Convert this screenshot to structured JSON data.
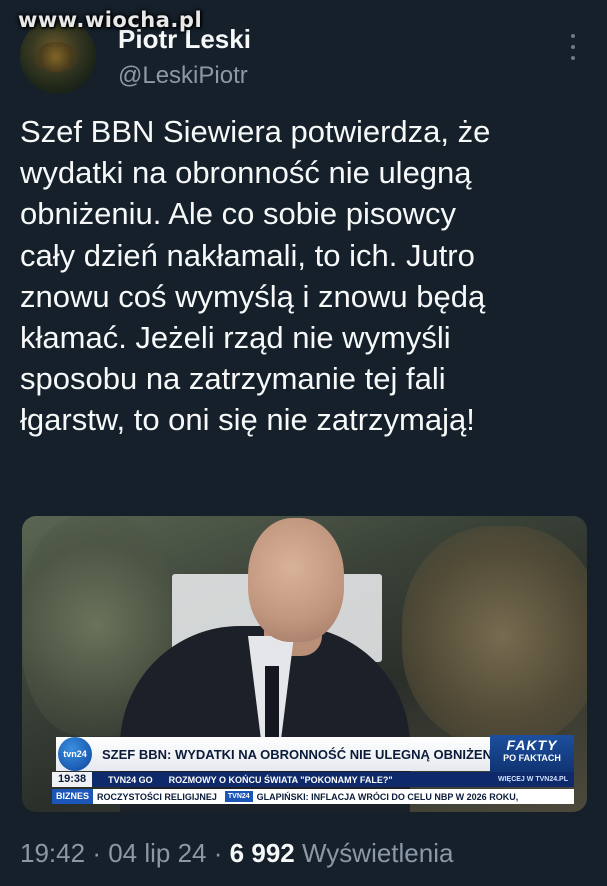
{
  "watermark": "www.wiocha.pl",
  "author": {
    "name": "Piotr Leski",
    "handle": "@LeskiPiotr"
  },
  "tweet": {
    "lines": [
      "Szef BBN Siewiera potwierdza, że",
      "wydatki na obronność nie ulegną",
      "obniżeniu. Ale co sobie pisowcy",
      "cały dzień nakłamali, to ich. Jutro",
      "znowu coś wymyślą i znowu będą",
      "kłamać. Jeżeli rząd nie wymyśli",
      "sposobu na zatrzymanie tej fali",
      "łgarstw, to oni się nie zatrzymają!"
    ]
  },
  "media": {
    "tvn_logo": "tvn24",
    "headline": "SZEF BBN: WYDATKI NA OBRONNOŚĆ NIE ULEGNĄ OBNIŻENIU",
    "fakty_title": "FAKTY",
    "fakty_sub": "PO FAKTACH",
    "clock": "19:38",
    "channel": "TVN24 GO",
    "program": "ROZMOWY O KOŃCU ŚWIATA \"POKONAMY FALE?\"",
    "more": "WIĘCEJ W TVN24.PL",
    "biz_label": "BIZNES",
    "ticker_left": "ROCZYSTOŚCI RELIGIJNEJ",
    "ticker_tag": "TVN24",
    "ticker_right": "GLAPIŃSKI: INFLACJA WRÓCI DO CELU NBP W 2026 ROKU,"
  },
  "footer": {
    "time": "19:42",
    "sep": "·",
    "date": "04 lip 24",
    "views_count": "6 992",
    "views_label": "Wyświetlenia"
  },
  "icons": [
    "more-options-icon",
    "tvn24-logo-icon"
  ]
}
